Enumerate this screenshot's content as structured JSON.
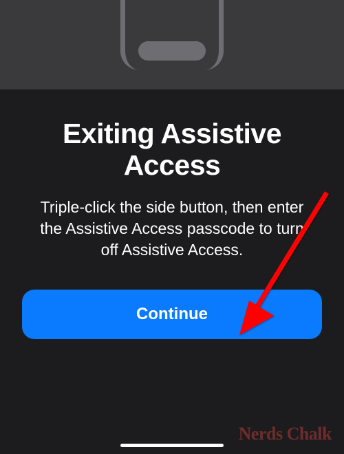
{
  "dialog": {
    "title": "Exiting Assistive Access",
    "description": "Triple-click the side button, then enter the Assistive Access passcode to turn off Assistive Access.",
    "continue_label": "Continue"
  },
  "watermark": {
    "text": "Nerds Chalk"
  },
  "colors": {
    "background": "#1c1c1e",
    "top_bar": "#3a3a3c",
    "outline": "#6e6e72",
    "button": "#0a7aff",
    "arrow": "#ff0000"
  }
}
